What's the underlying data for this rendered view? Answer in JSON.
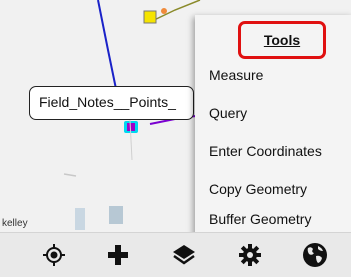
{
  "map": {
    "callout_label": "Field_Notes__Points_",
    "attribution": "kelley"
  },
  "menu": {
    "title": "Tools",
    "items": [
      {
        "label": "Measure"
      },
      {
        "label": "Query"
      },
      {
        "label": "Enter Coordinates"
      },
      {
        "label": "Copy Geometry"
      },
      {
        "label": "Buffer Geometry"
      }
    ]
  },
  "toolbar": {
    "buttons": [
      {
        "icon": "locate-icon"
      },
      {
        "icon": "add-icon"
      },
      {
        "icon": "layers-icon"
      },
      {
        "icon": "gear-icon"
      },
      {
        "icon": "globe-icon"
      }
    ]
  },
  "colors": {
    "highlight_border": "#e01010",
    "feature_line_blue": "#1a22c8",
    "feature_yellow": "#f5e400",
    "feature_magenta": "#a000c8",
    "feature_cyan": "#00d8f0",
    "feature_orange": "#f08a3a"
  }
}
